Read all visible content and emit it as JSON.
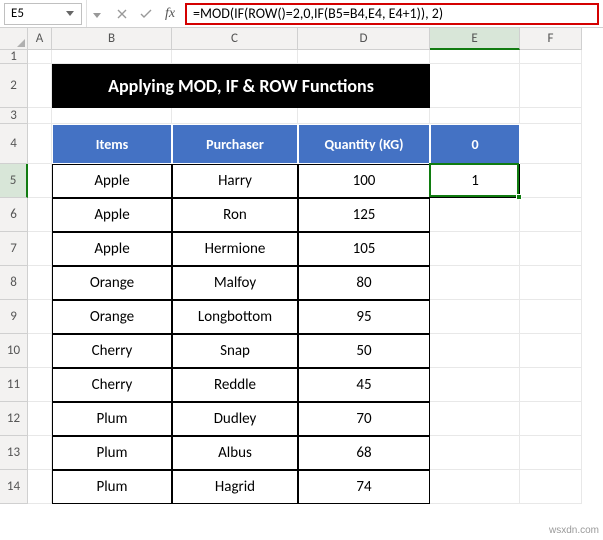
{
  "name_box": {
    "value": "E5"
  },
  "formula_bar": {
    "formula": "=MOD(IF(ROW()=2,0,IF(B5=B4,E4, E4+1)), 2)"
  },
  "columns": [
    {
      "letter": "A",
      "widthClass": "wA"
    },
    {
      "letter": "B",
      "widthClass": "wB"
    },
    {
      "letter": "C",
      "widthClass": "wC"
    },
    {
      "letter": "D",
      "widthClass": "wD"
    },
    {
      "letter": "E",
      "widthClass": "wE"
    },
    {
      "letter": "F",
      "widthClass": "wF"
    }
  ],
  "selected": {
    "col": "E",
    "row": 5
  },
  "title": "Applying MOD, IF & ROW Functions",
  "table": {
    "headers": {
      "B": "Items",
      "C": "Purchaser",
      "D": "Quantity (KG)",
      "E": "0"
    },
    "rows": [
      {
        "B": "Apple",
        "C": "Harry",
        "D": "100",
        "E": "1"
      },
      {
        "B": "Apple",
        "C": "Ron",
        "D": "125",
        "E": ""
      },
      {
        "B": "Apple",
        "C": "Hermione",
        "D": "105",
        "E": ""
      },
      {
        "B": "Orange",
        "C": "Malfoy",
        "D": "80",
        "E": ""
      },
      {
        "B": "Orange",
        "C": "Longbottom",
        "D": "95",
        "E": ""
      },
      {
        "B": "Cherry",
        "C": "Snap",
        "D": "50",
        "E": ""
      },
      {
        "B": "Cherry",
        "C": "Reddle",
        "D": "45",
        "E": ""
      },
      {
        "B": "Plum",
        "C": "Dudley",
        "D": "70",
        "E": ""
      },
      {
        "B": "Plum",
        "C": "Albus",
        "D": "68",
        "E": ""
      },
      {
        "B": "Plum",
        "C": "Hagrid",
        "D": "74",
        "E": ""
      }
    ]
  },
  "watermark": "wsxdn.com"
}
